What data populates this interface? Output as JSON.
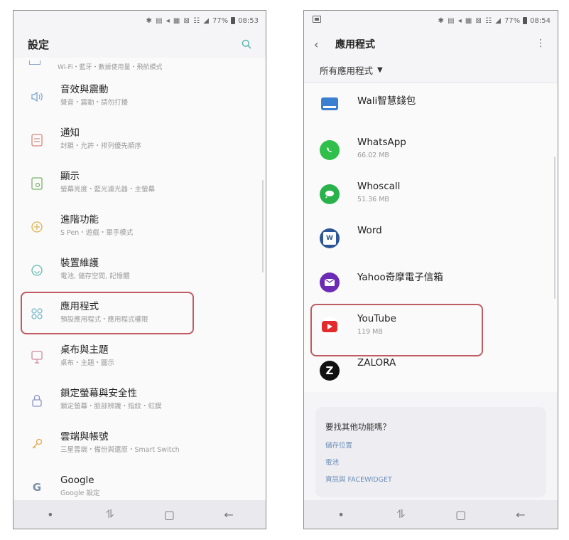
{
  "left": {
    "status": {
      "text": "77%",
      "time": "08:53"
    },
    "header_title": "設定",
    "top_partial_subtitle": "Wi-Fi・藍牙・數據使用量・飛航模式",
    "items": [
      {
        "title": "音效與震動",
        "subtitle": "聲音・震動・請勿打擾"
      },
      {
        "title": "通知",
        "subtitle": "封鎖・允許・排列優先順序"
      },
      {
        "title": "顯示",
        "subtitle": "螢幕亮度・藍光濾光器・主螢幕"
      },
      {
        "title": "進階功能",
        "subtitle": "S Pen・遊戲・單手模式"
      },
      {
        "title": "裝置維護",
        "subtitle": "電池, 儲存空間, 記憶體"
      },
      {
        "title": "應用程式",
        "subtitle": "預設應用程式・應用程式權限"
      },
      {
        "title": "桌布與主題",
        "subtitle": "桌布・主題・圖示"
      },
      {
        "title": "鎖定螢幕與安全性",
        "subtitle": "鎖定螢幕・臉部辨識・指紋・虹膜"
      },
      {
        "title": "雲端與帳號",
        "subtitle": "三星雲端・備份與還原・Smart Switch"
      },
      {
        "title": "Google",
        "subtitle": "Google 設定"
      }
    ]
  },
  "right": {
    "status": {
      "text": "77%",
      "time": "08:54"
    },
    "header_title": "應用程式",
    "filter_label": "所有應用程式",
    "apps": [
      {
        "name": "Wali智慧錢包",
        "size": ""
      },
      {
        "name": "WhatsApp",
        "size": "66.02 MB"
      },
      {
        "name": "Whoscall",
        "size": "51.36 MB"
      },
      {
        "name": "Word",
        "size": ""
      },
      {
        "name": "Yahoo奇摩電子信箱",
        "size": ""
      },
      {
        "name": "YouTube",
        "size": "119 MB"
      },
      {
        "name": "ZALORA",
        "size": ""
      }
    ],
    "card": {
      "title": "要找其他功能嗎？",
      "links": [
        "儲存位置",
        "電池",
        "資訊與 FACEWIDGET"
      ]
    }
  },
  "colors": {
    "highlight": "#c05a63",
    "link": "#6a8cb8",
    "youtube": "#e32b2b",
    "whatsapp": "#2fbf4a",
    "whoscall": "#29b24b",
    "word": "#2b5797",
    "yahoo": "#6b2bb5"
  }
}
